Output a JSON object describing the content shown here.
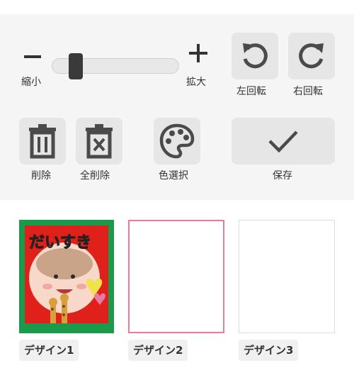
{
  "toolbar": {
    "zoom_out_label": "縮小",
    "zoom_in_label": "拡大",
    "rotate_left_label": "左回転",
    "rotate_right_label": "右回転",
    "delete_label": "削除",
    "delete_all_label": "全削除",
    "color_select_label": "色選択",
    "save_label": "保存",
    "zoom_level": 0.15
  },
  "designs": [
    {
      "label": "デザイン1",
      "selected": false,
      "has_image": true,
      "caption": "だいすき"
    },
    {
      "label": "デザイン2",
      "selected": true,
      "has_image": false
    },
    {
      "label": "デザイン3",
      "selected": false,
      "has_image": false
    }
  ],
  "colors": {
    "panel_bg": "#f5f5f5",
    "button_bg": "#e6e6e6",
    "icon": "#4a4a4a",
    "selected_border": "#e87aa6",
    "design1_frame": "#1a9a4a",
    "design1_bg": "#e0201a"
  },
  "icons": [
    "minus-icon",
    "plus-icon",
    "rotate-left-icon",
    "rotate-right-icon",
    "trash-icon",
    "trash-x-icon",
    "palette-icon",
    "check-icon"
  ]
}
